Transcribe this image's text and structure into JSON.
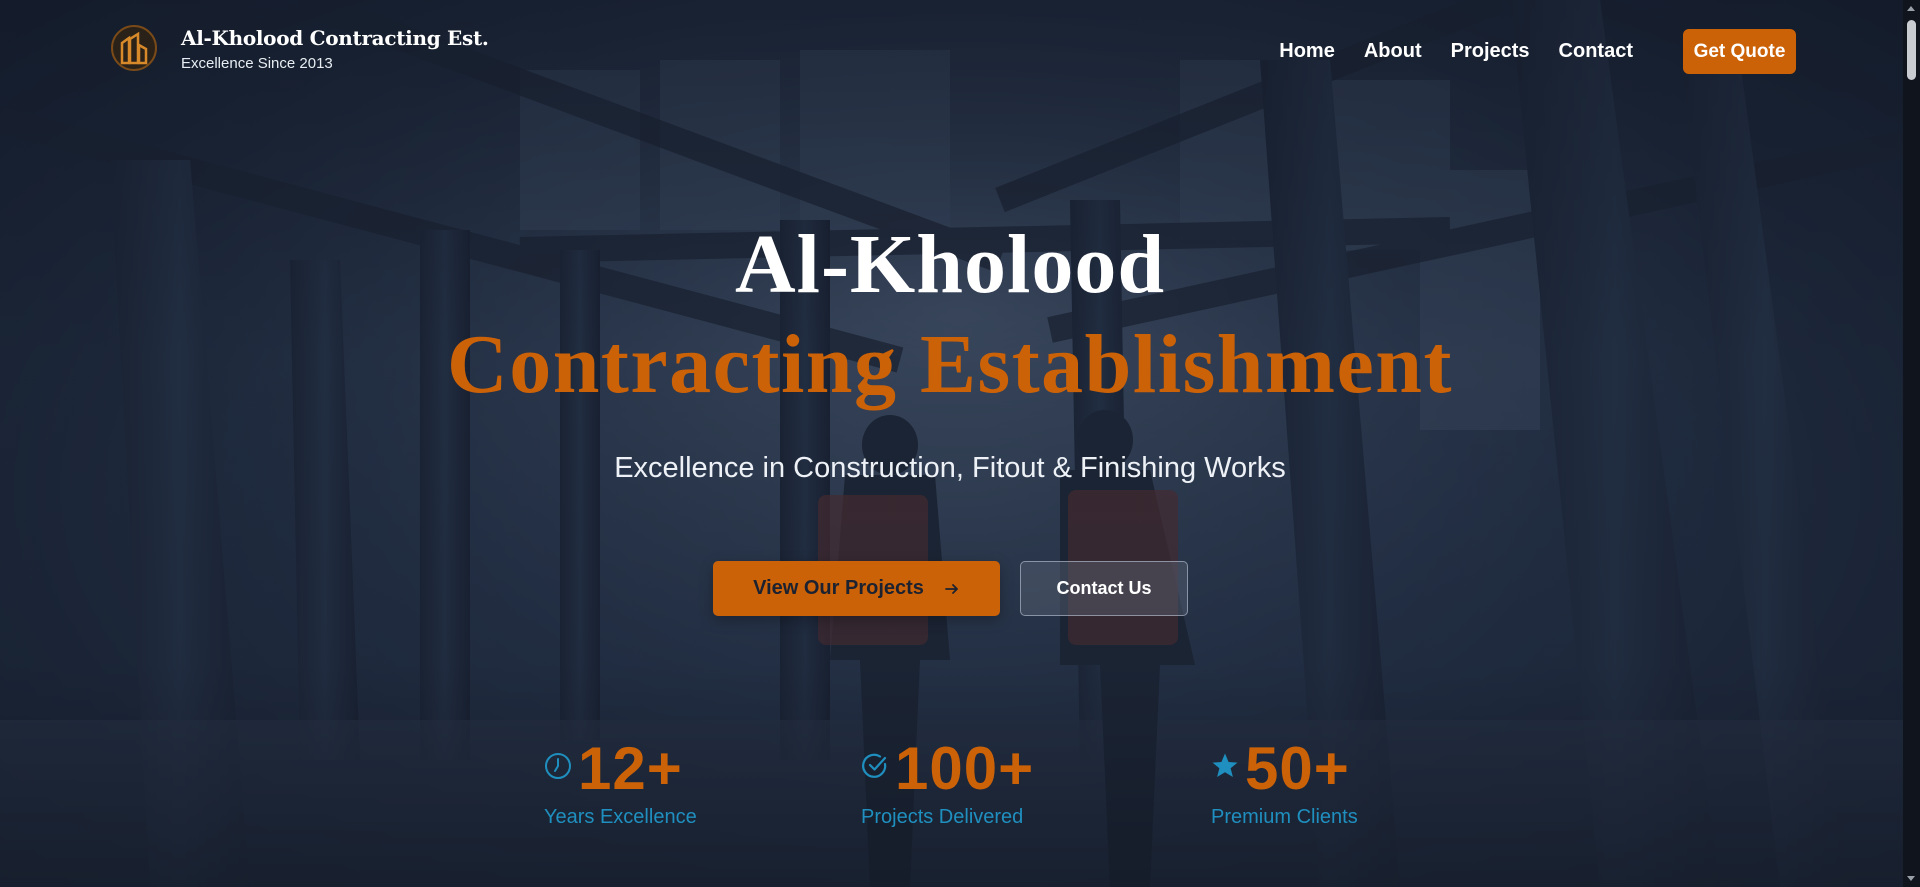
{
  "header": {
    "brand_name": "Al-Kholood Contracting Est.",
    "tagline": "Excellence Since 2013",
    "logo_icon": "building-logo-icon",
    "nav": [
      {
        "label": "Home"
      },
      {
        "label": "About"
      },
      {
        "label": "Projects"
      },
      {
        "label": "Contact"
      }
    ],
    "quote_button": "Get Quote"
  },
  "hero": {
    "title_line1": "Al-Kholood",
    "title_line2": "Contracting Establishment",
    "subtitle": "Excellence in Construction, Fitout & Finishing Works",
    "primary_button": "View Our Projects",
    "primary_icon": "arrow-right-icon",
    "secondary_button": "Contact Us"
  },
  "stats": [
    {
      "value": "12+",
      "label": "Years Excellence",
      "icon": "clock-icon"
    },
    {
      "value": "100+",
      "label": "Projects Delivered",
      "icon": "check-circle-icon"
    },
    {
      "value": "50+",
      "label": "Premium Clients",
      "icon": "star-icon"
    }
  ],
  "colors": {
    "accent": "#cc6208",
    "stat_label": "#1f8fbf",
    "background": "#1b2638"
  }
}
